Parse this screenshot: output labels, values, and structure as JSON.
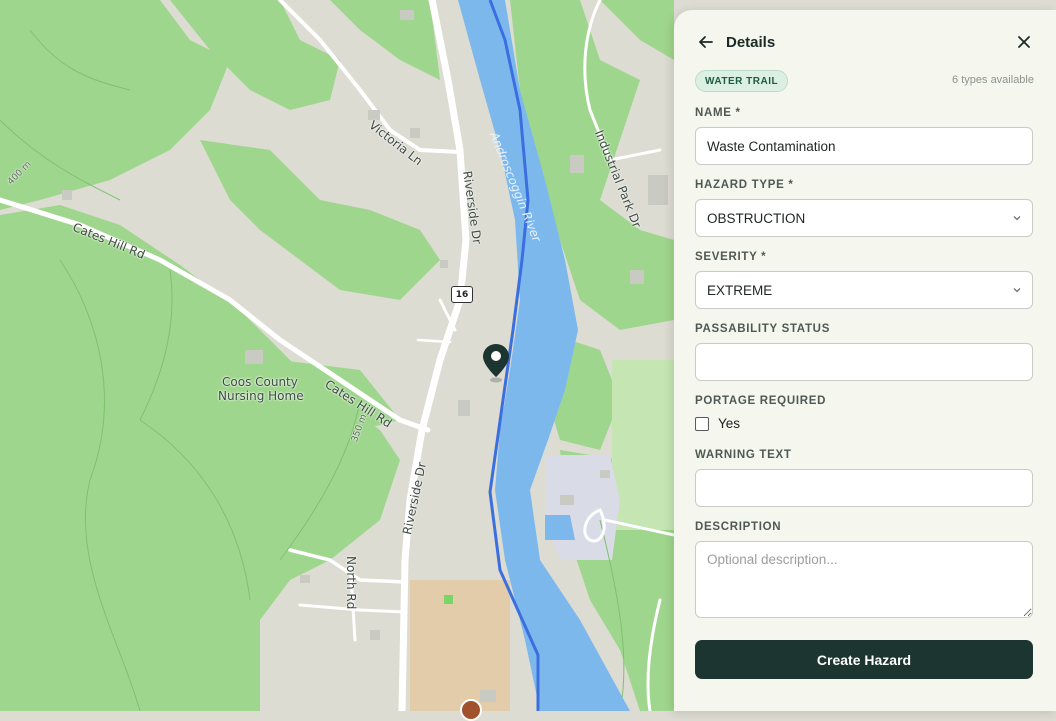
{
  "map": {
    "labels": {
      "victoria_ln": "Victoria Ln",
      "riverside_dr_north": "Riverside Dr",
      "riverside_dr_south": "Riverside Dr",
      "cates_hill_rd_west": "Cates Hill Rd",
      "cates_hill_rd_east": "Cates Hill Rd",
      "industrial_park_dr": "Industrial Park Dr",
      "coos_county_line1": "Coos County",
      "coos_county_line2": "Nursing Home",
      "north_rd": "North Rd",
      "river": "Androscoggin River",
      "contour_400": "400 m",
      "contour_350": "350 m"
    },
    "route_shield": "16",
    "colors": {
      "forest": "#9fd68d",
      "land": "#dcdcd2",
      "water": "#7db8ed",
      "route": "#3b6fe0",
      "pin": "#1c3530"
    }
  },
  "panel": {
    "title": "Details",
    "back_icon": "arrow-left-icon",
    "close_icon": "close-icon",
    "badge": "WATER TRAIL",
    "types_available": "6 types available",
    "name_label": "NAME *",
    "name_value": "Waste Contamination",
    "hazard_type_label": "HAZARD TYPE *",
    "hazard_type_value": "OBSTRUCTION",
    "severity_label": "SEVERITY *",
    "severity_value": "EXTREME",
    "passability_label": "PASSABILITY STATUS",
    "passability_value": "",
    "portage_label": "PORTAGE REQUIRED",
    "portage_option": "Yes",
    "portage_checked": false,
    "warning_label": "WARNING TEXT",
    "warning_value": "",
    "description_label": "DESCRIPTION",
    "description_placeholder": "Optional description...",
    "submit_label": "Create Hazard"
  }
}
